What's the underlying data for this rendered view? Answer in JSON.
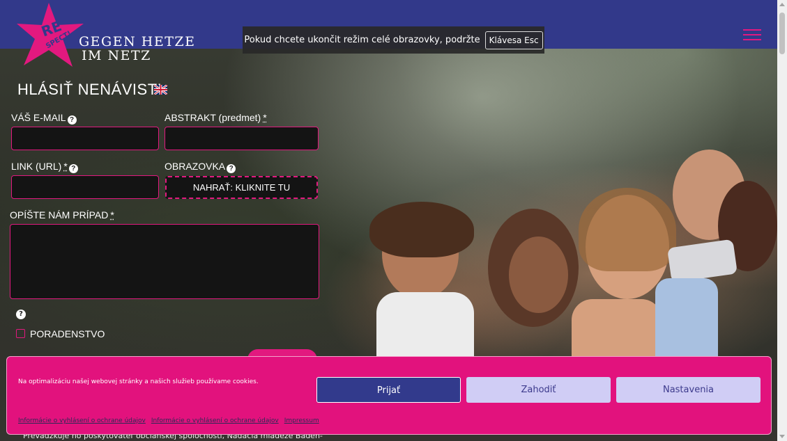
{
  "header": {
    "logo_badge": "RE SPECT!",
    "logo_line1": "GEGEN HETZE",
    "logo_line2": "IM NETZ"
  },
  "fullscreen_notice": {
    "text": "Pokud chcete ukončit režim celé obrazovky, podržte",
    "key": "Klávesa Esc"
  },
  "form": {
    "title": "HLÁSIŤ NENÁVIST!",
    "email_label": "VÁŠ E-MAIL",
    "subject_label": "ABSTRAKT (predmet)",
    "link_label": "LINK (URL)",
    "screenshot_label": "OBRAZOVKA",
    "upload_button": "NAHRAŤ: KLIKNITE TU",
    "describe_label": "OPÍŠTE NÁM PRÍPAD",
    "required_mark": "*",
    "help_mark": "?",
    "counseling_label": "PORADENSTVO"
  },
  "footer_peek": "Prevádzkuje ho poskytovateľ občianskej spoločnosti, Nadácia mládeže Baden-",
  "cookie": {
    "message": "Na optimalizáciu našej webovej stránky a našich služieb používame cookies.",
    "accept": "Prijať",
    "deny": "Zahodiť",
    "settings": "Nastavenia",
    "links": [
      "Informácie o vyhlásení o ochrane údajov",
      "Informácie o vyhlásení o ochrane údajov",
      "Impressum"
    ]
  },
  "colors": {
    "header_bg": "#32398a",
    "accent_pink": "#e2197f",
    "cookie_bg": "#e2127d",
    "accept_bg": "#323a8c",
    "secondary_btn_bg": "#d0cdf5"
  }
}
